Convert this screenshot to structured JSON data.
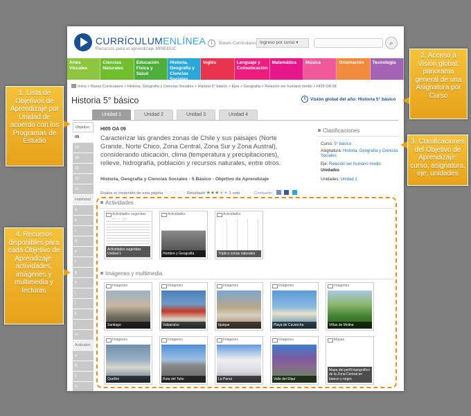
{
  "header": {
    "logo_main": "CURRÍCULUM",
    "logo_accent": "ENLÍNEA",
    "logo_sub": "Recursos para el aprendizaje MINEDUC",
    "bases": "Bases Curriculares",
    "ingreso": "Ingreso por curso",
    "search_placeholder": ""
  },
  "nav": [
    {
      "label": "Artes Visuales",
      "color": "#8cc63f"
    },
    {
      "label": "Ciencias Naturales",
      "color": "#6ebe2d"
    },
    {
      "label": "Educación Física y Salud",
      "color": "#4dae3c"
    },
    {
      "label": "Historia, Geografía y Ciencias Sociales",
      "color": "#2aa6d8"
    },
    {
      "label": "Inglés",
      "color": "#e8344e"
    },
    {
      "label": "Lenguaje y Comunicación",
      "color": "#ed1c7e"
    },
    {
      "label": "Matemática",
      "color": "#e5178a"
    },
    {
      "label": "Música",
      "color": "#f15a9a"
    },
    {
      "label": "Orientación",
      "color": "#f28a3d"
    },
    {
      "label": "Tecnología",
      "color": "#a463b5"
    }
  ],
  "breadcrumb": "Inicio > Bases Curriculares > Historia, Geografía y Ciencias Sociales > Historia 5° básico > Ejes > Geografía > Relación ser humano medio > HI05 OA 09",
  "page_title": "Historia 5° básico",
  "vision_link": "Visión global del año: Historia 5° básico",
  "tabs": [
    "Unidad 1",
    "Unidad 2",
    "Unidad 3",
    "Unidad 4"
  ],
  "left_list": [
    "Objetivo",
    "09",
    "10",
    "16",
    "11",
    "12",
    "22",
    "Habilidad",
    "a",
    "b",
    "c",
    "d",
    "e",
    "f",
    "g",
    "h",
    "i",
    "j",
    "k",
    "l",
    "m",
    "Actitudes",
    "a",
    "B",
    "F",
    "G"
  ],
  "oa": {
    "code": "HI05 OA 09",
    "text": "Caracterizar las grandes zonas de Chile y sus paisajes (Norte Grande, Norte Chico, Zona Central, Zona Sur y Zona Austral), considerando ubicación, clima (temperatura y precipitaciones), relieve, hidrografía, población y recursos naturales, entre otros.",
    "source": "Historia, Geografía y Ciencias Sociales - 5 Básico - Objetivo de Aprendizaje"
  },
  "clasificaciones": {
    "title": "Clasificaciones",
    "curso_label": "Curso:",
    "curso": "5° básico",
    "asignatura_label": "Asignatura:",
    "asignatura": "Historia, Geografía y Ciencias Sociales",
    "eje_label": "Eje:",
    "eje": "Relación ser humano medio",
    "unidades_hdr": "Unidades",
    "unidades_label": "Unidades:",
    "unidades": "Unidad 1"
  },
  "rating": {
    "label": "Evalúe el contenido de esta página",
    "result_label": "Resultado",
    "votes": "1 voto",
    "share": "Compartir:"
  },
  "actividades": {
    "title": "Actividades",
    "cards": [
      {
        "header": "Actividades sugeridas Unidad 1",
        "caption": "Actividades sugeridas Unidad 1"
      },
      {
        "header": "Actividades",
        "caption": "Hombre y Geografía"
      },
      {
        "header": "Actividades",
        "caption": "Tríptico zonas naturales"
      }
    ]
  },
  "imagenes": {
    "title": "Imágenes y multimedia",
    "header_label": "Imágenes",
    "cards": [
      {
        "caption": "Santiago",
        "bg": "linear-gradient(#9fb3c8 0%,#c8b8a0 40%,#6d6a60 70%,#4d4a42 100%)"
      },
      {
        "caption": "Valparaíso",
        "bg": "linear-gradient(#4a7fb8 0%,#6f9ac8 35%,#c23a2a 55%,#d9d0c0 75%,#5d6c7a 100%)"
      },
      {
        "caption": "Iquique",
        "bg": "linear-gradient(#7fa6d0 0%,#b8a888 45%,#d8d0c0 65%,#8b7a60 100%)"
      },
      {
        "caption": "Playa de Cavancha",
        "bg": "linear-gradient(#5a9ad8 0%,#8cbce0 45%,#e8e0c8 60%,#3d7fae 100%)"
      },
      {
        "caption": "Viñas de Molina",
        "bg": "linear-gradient(#a8c8e8 0%,#8fb870 35%,#3f7f2f 70%,#2f5f20 100%)"
      },
      {
        "caption": "Quellón",
        "bg": "linear-gradient(#6f8fb0 0%,#9ab0c0 40%,#d8d8d0 60%,#4f6a80 100%)"
      },
      {
        "caption": "Ruta del Tatio",
        "bg": "linear-gradient(#4f8fd8 0%,#9fc0e0 40%,#888 55%,#5f5f5f 100%)"
      },
      {
        "caption": "La Parva",
        "bg": "linear-gradient(#5f9ae0 0%,#f0f0f0 40%,#d8d8e0 70%,#8f8f8f 100%)"
      },
      {
        "caption": "Valle del Elqui",
        "bg": "linear-gradient(#3f7fd0 0%,#7a5aa0 35%,#8a6a90 60%,#4f8f40 100%)"
      }
    ],
    "map_card": {
      "header": "Mapas",
      "caption": "Mapa del perfil topográfico de la Zona Central en blanco y negro"
    }
  },
  "callouts": [
    {
      "text": "1. Lista de Objetivos de Aprendizaje por Unidad de acuerdo con los Programas de Estudio"
    },
    {
      "text": "2. Acceso a Visión global: panorama general de una Asignatura por Curso"
    },
    {
      "text": "3. Clasificaciones del Objetivo de Aprendizaje: curso, asignatura, eje, unidades"
    },
    {
      "text": "4. Recursos disponibles para cada Objetivo de Aprendizaje: actividades, imágenes y multimedia y lecturas"
    }
  ]
}
